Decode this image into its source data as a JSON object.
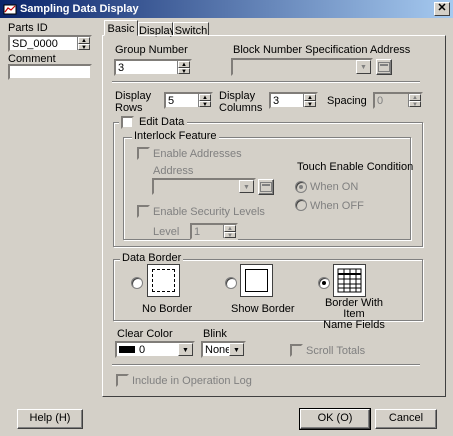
{
  "window": {
    "title": "Sampling Data Display"
  },
  "left_panel": {
    "parts_id_label": "Parts ID",
    "parts_id_value": "SD_0000",
    "comment_label": "Comment",
    "comment_value": ""
  },
  "tabs": [
    {
      "label": "Basic"
    },
    {
      "label": "Display"
    },
    {
      "label": "Switch"
    }
  ],
  "basic": {
    "group_number_label": "Group Number",
    "group_number_value": "3",
    "block_spec_label": "Block Number Specification Address",
    "block_spec_value": "",
    "display_rows_label_1": "Display",
    "display_rows_label_2": "Rows",
    "display_rows_value": "5",
    "display_columns_label_1": "Display",
    "display_columns_label_2": "Columns",
    "display_columns_value": "3",
    "spacing_label": "Spacing",
    "spacing_value": "0",
    "edit_data_label": "Edit Data",
    "interlock_title": "Interlock Feature",
    "enable_addresses_label": "Enable Addresses",
    "address_label": "Address",
    "address_value": "",
    "touch_enable_label": "Touch Enable Condition",
    "when_on_label": "When ON",
    "when_off_label": "When OFF",
    "enable_security_label": "Enable Security Levels",
    "level_label": "Level",
    "level_value": "1",
    "data_border_title": "Data Border",
    "border_options": [
      {
        "label": "No Border"
      },
      {
        "label": "Show Border"
      },
      {
        "label_line1": "Border With Item",
        "label_line2": "Name Fields"
      }
    ],
    "clear_color_label": "Clear Color",
    "clear_color_value": "0",
    "blink_label": "Blink",
    "blink_value": "None",
    "scroll_totals_label": "Scroll Totals",
    "include_log_label": "Include in Operation Log"
  },
  "footer": {
    "help_label": "Help (H)",
    "ok_label": "OK (O)",
    "cancel_label": "Cancel"
  }
}
